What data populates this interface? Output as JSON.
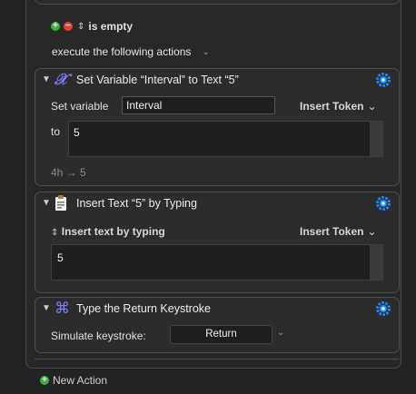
{
  "condition": {
    "label": "is empty",
    "execute_label": "execute the following actions"
  },
  "actions": [
    {
      "title": "Set Variable “Interval” to Text “5”",
      "set_variable_label": "Set variable",
      "variable_value": "Interval",
      "insert_token_label": "Insert Token",
      "to_label": "to",
      "text_value": "5",
      "preview": "4h → 5"
    },
    {
      "title": "Insert Text “5” by Typing",
      "mode_label": "Insert text by typing",
      "insert_token_label": "Insert Token",
      "text_value": "5"
    },
    {
      "title": "Type the Return Keystroke",
      "simulate_label": "Simulate keystroke:",
      "keystroke_value": "Return"
    }
  ],
  "footer": {
    "new_action_label": "New Action"
  },
  "colors": {
    "background": "#232323",
    "panel": "#2c2c2c",
    "gear_blue": "#1a8cff",
    "add_green": "#3fae3f",
    "remove_red": "#e0413c"
  }
}
